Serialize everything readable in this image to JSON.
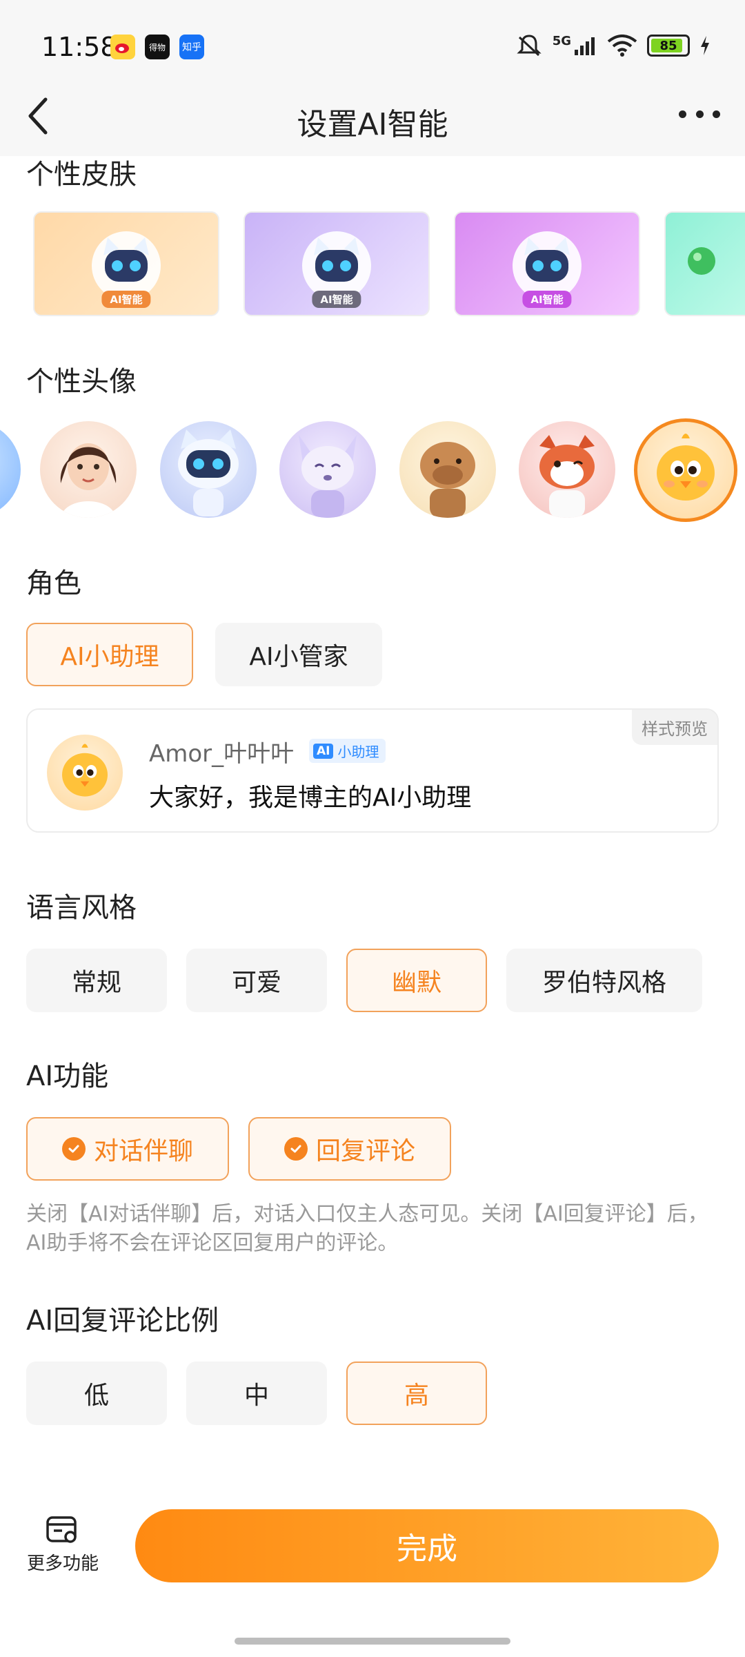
{
  "status": {
    "time": "11:58",
    "apps": [
      "weibo-icon",
      "dewu-icon",
      "zhihu-icon"
    ],
    "app_labels": {
      "dewu": "得物",
      "zhihu": "知乎"
    },
    "network": "5G",
    "battery": "85",
    "battery_level": 0.85
  },
  "nav": {
    "title": "设置AI智能"
  },
  "skins": {
    "title": "个性皮肤",
    "badge": "AI智能",
    "items": [
      {
        "name": "space-skin",
        "colors": [
          "#ffd9a8",
          "#ffe9c9"
        ],
        "badge_color": "#f08a3a"
      },
      {
        "name": "fashion-skin",
        "colors": [
          "#c9b3f7",
          "#ece3ff"
        ],
        "badge_color": "#6d6a7c"
      },
      {
        "name": "purple-skin",
        "colors": [
          "#d98bf2",
          "#f3c7ff"
        ],
        "badge_color": "#c64fe3"
      },
      {
        "name": "mint-skin",
        "colors": [
          "#8ff0d6",
          "#d6fff2"
        ],
        "badge_color": "#2fb78f"
      }
    ]
  },
  "avatars": {
    "title": "个性头像",
    "items": [
      "girl-avatar",
      "robot-cat-avatar",
      "fox-robot-avatar",
      "capybara-avatar",
      "red-panda-avatar",
      "chick-avatar"
    ],
    "selected": "chick-avatar"
  },
  "role": {
    "title": "角色",
    "options": [
      "AI小助理",
      "AI小管家"
    ],
    "selected": "AI小助理"
  },
  "preview": {
    "tag": "样式预览",
    "name": "Amor_叶叶叶",
    "badge_ai": "AI",
    "badge": "小助理",
    "text": "大家好，我是博主的AI小助理"
  },
  "language": {
    "title": "语言风格",
    "options": [
      "常规",
      "可爱",
      "幽默",
      "罗伯特风格"
    ],
    "selected": "幽默"
  },
  "features": {
    "title": "AI功能",
    "options": [
      "对话伴聊",
      "回复评论"
    ],
    "note": "关闭【AI对话伴聊】后，对话入口仅主人态可见。关闭【AI回复评论】后，AI助手将不会在评论区回复用户的评论。"
  },
  "ratio": {
    "title": "AI回复评论比例",
    "options": [
      "低",
      "中",
      "高"
    ],
    "selected": "高"
  },
  "bottom": {
    "more_label": "更多功能",
    "done_label": "完成"
  },
  "colors": {
    "accent": "#f5831f",
    "chip_bg": "#f5f5f5",
    "active_bg": "#fff7ef"
  }
}
